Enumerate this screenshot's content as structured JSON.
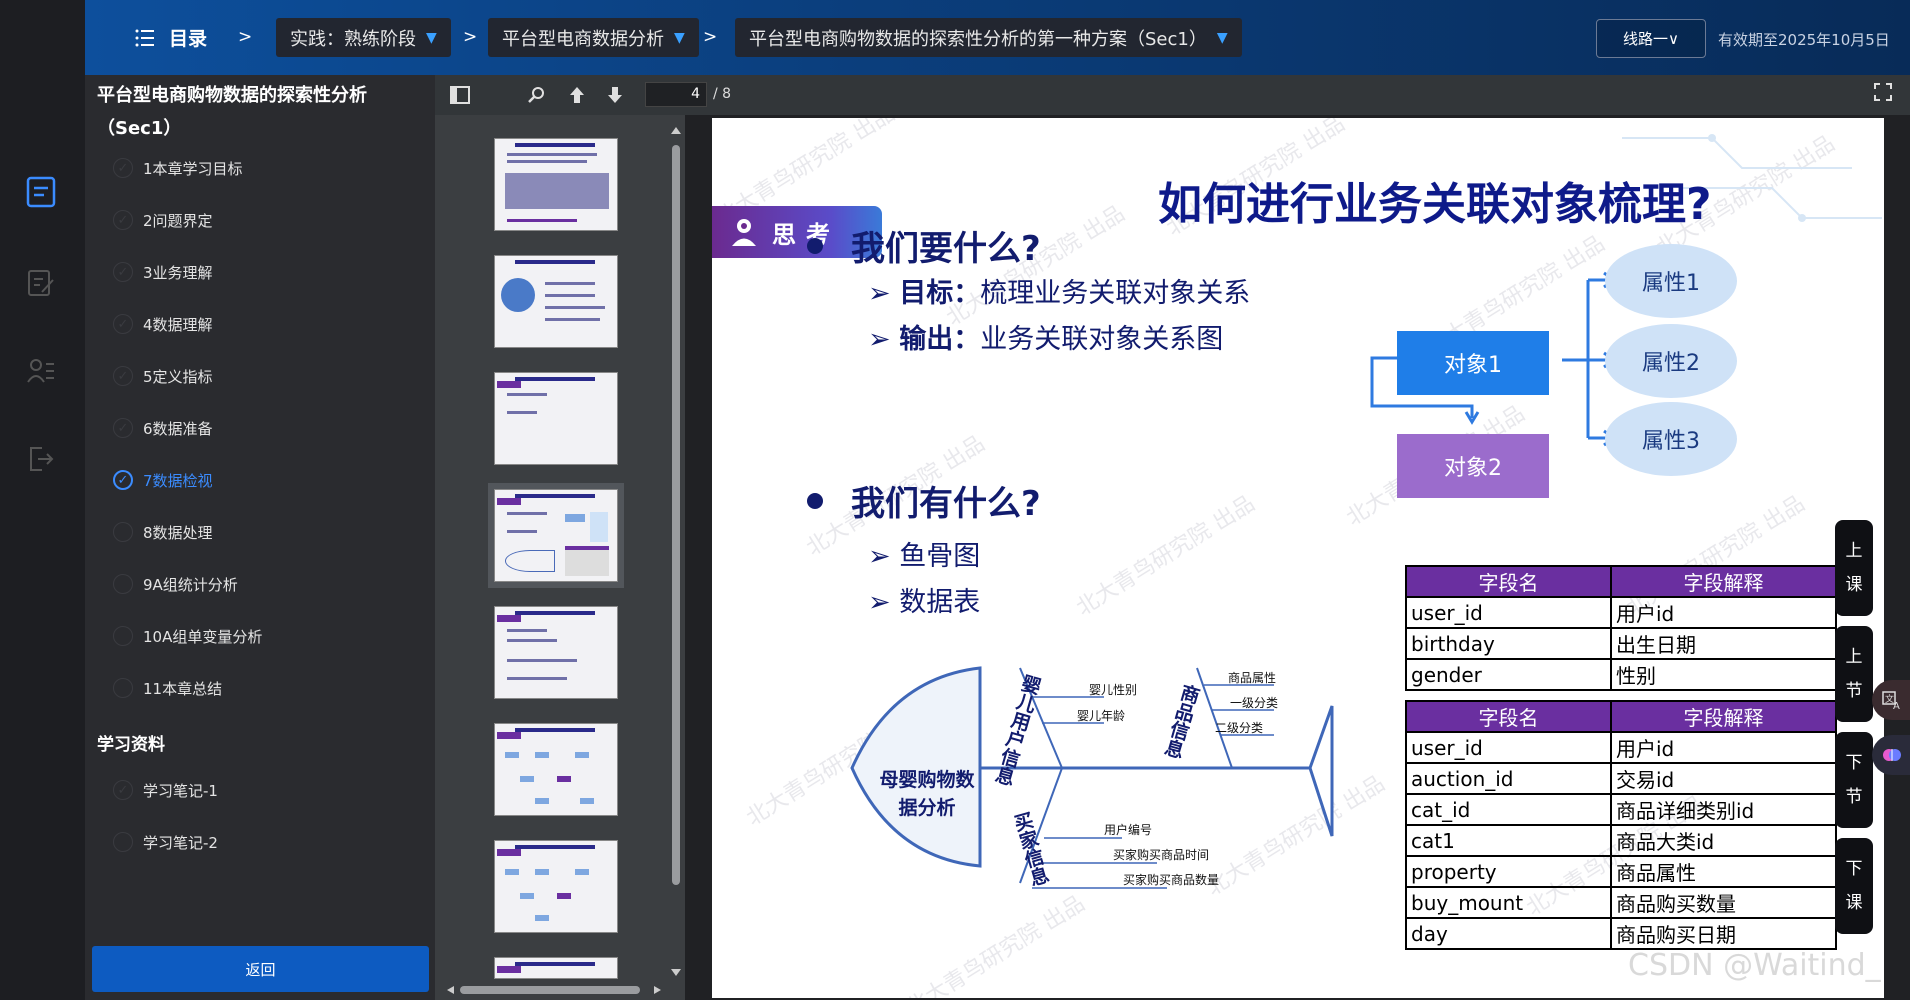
{
  "topbar": {
    "toc_label": "目录",
    "crumbs": [
      "实践：熟练阶段",
      "平台型电商数据分析",
      "平台型电商购物数据的探索性分析的第一种方案（Sec1）"
    ],
    "line_label": "线路一∨",
    "expiry": "有效期至2025年10月5日"
  },
  "sidebar": {
    "title": "平台型电商购物数据的探索性分析（Sec1）",
    "items": [
      {
        "label": "1本章学习目标",
        "done": true
      },
      {
        "label": "2问题界定",
        "done": true
      },
      {
        "label": "3业务理解",
        "done": true
      },
      {
        "label": "4数据理解",
        "done": true
      },
      {
        "label": "5定义指标",
        "done": true
      },
      {
        "label": "6数据准备",
        "done": true
      },
      {
        "label": "7数据检视",
        "active": true
      },
      {
        "label": "8数据处理",
        "done": false
      },
      {
        "label": "9A组统计分析",
        "done": false
      },
      {
        "label": "10A组单变量分析",
        "done": false
      },
      {
        "label": "11本章总结",
        "done": false
      }
    ],
    "materials_title": "学习资料",
    "materials": [
      {
        "label": "学习笔记-1",
        "done": true
      },
      {
        "label": "学习笔记-2",
        "done": false
      }
    ],
    "back_label": "返回"
  },
  "pdf": {
    "page": "4",
    "total": "/ 8"
  },
  "slide": {
    "title": "如何进行业务关联对象梳理?",
    "think_label": "思考",
    "q1": "我们要什么?",
    "goal_key": "目标：",
    "goal_val": "梳理业务关联对象关系",
    "out_key": "输出：",
    "out_val": "业务关联对象关系图",
    "q2": "我们有什么?",
    "have1": "鱼骨图",
    "have2": "数据表",
    "obj1": "对象1",
    "obj2": "对象2",
    "attrs": [
      "属性1",
      "属性2",
      "属性3"
    ],
    "table1": {
      "headers": [
        "字段名",
        "字段解释"
      ],
      "rows": [
        [
          "user_id",
          "用户id"
        ],
        [
          "birthday",
          "出生日期"
        ],
        [
          "gender",
          "性别"
        ]
      ]
    },
    "table2": {
      "headers": [
        "字段名",
        "字段解释"
      ],
      "rows": [
        [
          "user_id",
          "用户id"
        ],
        [
          "auction_id",
          "交易id"
        ],
        [
          "cat_id",
          "商品详细类别id"
        ],
        [
          "cat1",
          "商品大类id"
        ],
        [
          "property",
          "商品属性"
        ],
        [
          "buy_mount",
          "商品购买数量"
        ],
        [
          "day",
          "商品购买日期"
        ]
      ]
    },
    "fish": {
      "head": "母婴购物数据分析",
      "cat1": "婴儿用户信息",
      "cat2": "商品信息",
      "cat3": "买家信息",
      "cat1_items": [
        "婴儿性别",
        "婴儿年龄"
      ],
      "cat2_items": [
        "商品属性",
        "一级分类",
        "二级分类"
      ],
      "cat3_items": [
        "用户编号",
        "买家购买商品时间",
        "买家购买商品数量"
      ]
    },
    "watermark": "北大青鸟研究院 出品"
  },
  "nav": {
    "prev_lesson": "上课",
    "prev_section": "上节",
    "next_section": "下节",
    "next_lesson": "下课"
  },
  "corner_watermark": "CSDN @Waitind_"
}
